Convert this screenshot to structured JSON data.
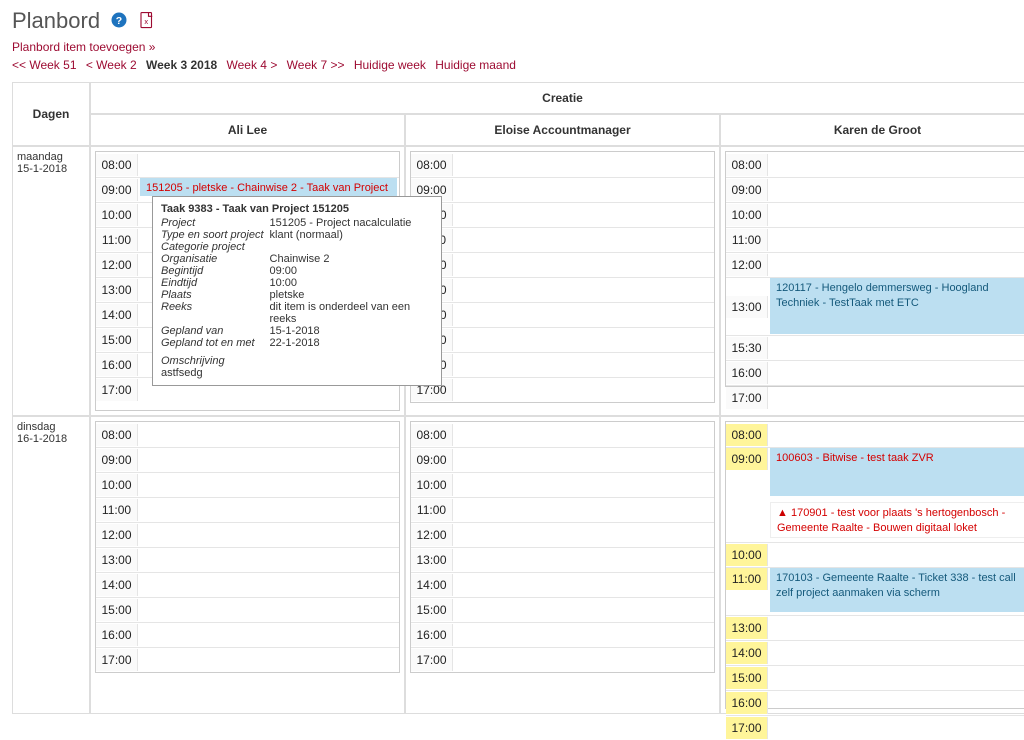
{
  "header": {
    "title": "Planbord",
    "add_link": "Planbord item toevoegen",
    "add_link_arrow": "»"
  },
  "weeknav": {
    "prev2": "<< Week 51",
    "prev1": "< Week 2",
    "current": "Week 3 2018",
    "next1": "Week 4 >",
    "next2": "Week 7 >>",
    "today_week": "Huidige week",
    "today_month": "Huidige maand"
  },
  "columns": {
    "days": "Dagen",
    "group": "Creatie",
    "p1": "Ali Lee",
    "p2": "Eloise Accountmanager",
    "p3": "Karen de Groot"
  },
  "days": {
    "mon": {
      "name": "maandag",
      "date": "15-1-2018"
    },
    "tue": {
      "name": "dinsdag",
      "date": "16-1-2018"
    }
  },
  "hours_std": [
    "08:00",
    "09:00",
    "10:00",
    "11:00",
    "12:00",
    "13:00",
    "14:00",
    "15:00",
    "16:00",
    "17:00"
  ],
  "hours_karen_mon": [
    "08:00",
    "09:00",
    "10:00",
    "11:00",
    "12:00",
    "13:00",
    "15:30",
    "16:00",
    "17:00"
  ],
  "hours_karen_tue": [
    "08:00",
    "09:00",
    "10:00",
    "11:00",
    "13:00",
    "14:00",
    "15:00",
    "16:00",
    "17:00"
  ],
  "events": {
    "ali_mon_title": "151205 - pletske - Chainwise 2 - Taak van Project",
    "karen_mon_title": "120117 - Hengelo demmersweg - Hoogland Techniek - TestTaak met ETC",
    "karen_tue_a": "100603 - Bitwise - test taak ZVR",
    "karen_tue_b": "170901 - test voor plaats 's hertogenbosch - Gemeente Raalte - Bouwen digitaal loket",
    "karen_tue_c": "170103 - Gemeente Raalte - Ticket 338 - test call zelf project aanmaken via scherm"
  },
  "tooltip": {
    "title": "Taak 9383 - Taak van Project 151205",
    "rows": [
      [
        "Project",
        "151205 - Project nacalculatie"
      ],
      [
        "Type en soort project",
        "klant (normaal)"
      ],
      [
        "Categorie project",
        ""
      ],
      [
        "Organisatie",
        "Chainwise 2"
      ],
      [
        "Begintijd",
        "09:00"
      ],
      [
        "Eindtijd",
        "10:00"
      ],
      [
        "Plaats",
        "pletske"
      ],
      [
        "Reeks",
        "dit item is onderdeel van een reeks"
      ],
      [
        "Gepland van",
        "15-1-2018"
      ],
      [
        "Gepland tot en met",
        "22-1-2018"
      ]
    ],
    "desc_label": "Omschrijving",
    "desc_value": "astfsedg"
  }
}
